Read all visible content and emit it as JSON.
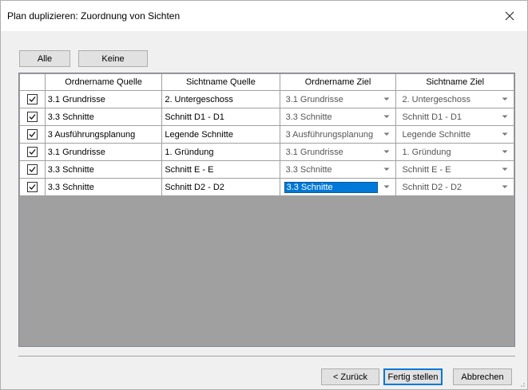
{
  "window": {
    "title": "Plan duplizieren: Zuordnung von Sichten"
  },
  "toolbar": {
    "all_label": "Alle",
    "none_label": "Keine"
  },
  "table": {
    "headers": [
      "Ordnername Quelle",
      "Sichtname Quelle",
      "Ordnername Ziel",
      "Sichtname Ziel"
    ],
    "rows": [
      {
        "checked": true,
        "src_folder": "3.1 Grundrisse",
        "src_view": "2. Untergeschoss",
        "dst_folder": "3.1 Grundrisse",
        "dst_view": "2. Untergeschoss"
      },
      {
        "checked": true,
        "src_folder": "3.3 Schnitte",
        "src_view": "Schnitt D1 - D1",
        "dst_folder": "3.3 Schnitte",
        "dst_view": "Schnitt D1 - D1"
      },
      {
        "checked": true,
        "src_folder": "3 Ausführungsplanung",
        "src_view": "Legende Schnitte",
        "dst_folder": "3 Ausführungsplanung",
        "dst_view": "Legende Schnitte"
      },
      {
        "checked": true,
        "src_folder": "3.1 Grundrisse",
        "src_view": "1. Gründung",
        "dst_folder": "3.1 Grundrisse",
        "dst_view": "1. Gründung"
      },
      {
        "checked": true,
        "src_folder": "3.3 Schnitte",
        "src_view": "Schnitt E - E",
        "dst_folder": "3.3 Schnitte",
        "dst_view": "Schnitt E - E"
      },
      {
        "checked": true,
        "src_folder": "3.3 Schnitte",
        "src_view": "Schnitt D2 - D2",
        "dst_folder": "3.3 Schnitte",
        "dst_view": "Schnitt D2 - D2"
      }
    ]
  },
  "footer": {
    "back_label": "< Zurück",
    "finish_label": "Fertig stellen",
    "cancel_label": "Abbrechen"
  },
  "colors": {
    "selection": "#0078d7",
    "grid_background": "#a0a0a0",
    "default_button_border": "#0078d7"
  }
}
